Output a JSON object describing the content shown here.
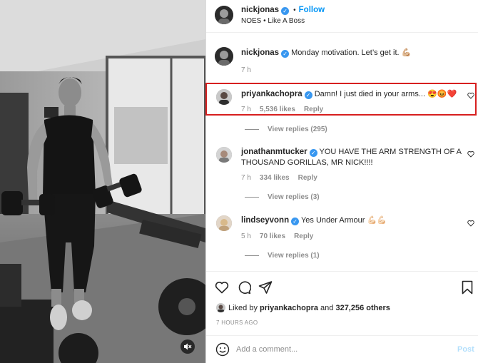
{
  "post": {
    "author": "nickjonas",
    "follow_label": "Follow",
    "audio": "NOES • Like A Boss",
    "icons": {
      "verified": "verified-badge-icon",
      "mute": "speaker-muted-icon"
    }
  },
  "caption": {
    "username": "nickjonas",
    "text": "Monday motivation. Let’s get it. 💪🏼",
    "time": "7 h"
  },
  "comments": [
    {
      "username": "priyankachopra",
      "text": "Damn! I just died in your arms... 😍😡❤️",
      "time": "7 h",
      "likes": "5,536 likes",
      "reply_label": "Reply",
      "view_replies": "View replies (295)",
      "highlighted": true
    },
    {
      "username": "jonathanmtucker",
      "text": "YOU HAVE THE ARM STRENGTH OF A THOUSAND GORILLAS, MR NICK!!!!",
      "time": "7 h",
      "likes": "334 likes",
      "reply_label": "Reply",
      "view_replies": "View replies (3)"
    },
    {
      "username": "lindseyvonn",
      "text": "Yes Under Armour 💪🏻💪🏻",
      "time": "5 h",
      "likes": "70 likes",
      "reply_label": "Reply",
      "view_replies": "View replies (1)"
    }
  ],
  "actions": {
    "icons": [
      "heart-icon",
      "comment-icon",
      "share-icon",
      "bookmark-icon"
    ],
    "liked_prefix": "Liked by",
    "liked_user": "priyankachopra",
    "liked_and": "and",
    "liked_count": "327,256 others",
    "time_ago": "7 HOURS AGO"
  },
  "add_comment": {
    "placeholder": "Add a comment...",
    "post_label": "Post"
  },
  "colors": {
    "link_blue": "#0095f6",
    "verified_blue": "#3897f0",
    "highlight_red": "#d71f1f",
    "muted_gray": "#8e8e8e",
    "post_disabled": "#b2dffc"
  }
}
